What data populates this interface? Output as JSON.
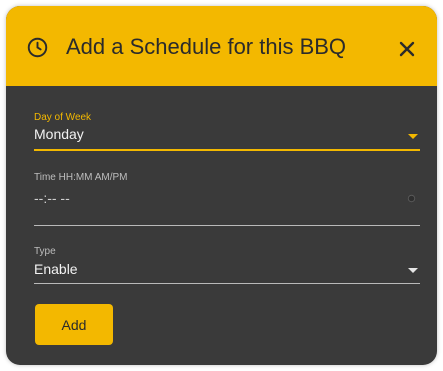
{
  "dialog": {
    "title": "Add a Schedule for this BBQ",
    "header_icon": "clock-icon",
    "close_icon": "close-icon"
  },
  "form": {
    "day_of_week": {
      "label": "Day of Week",
      "value": "Monday",
      "state": "focused",
      "icon": "dropdown-caret-icon"
    },
    "time": {
      "label": "Time HH:MM AM/PM",
      "value": "--:-- --",
      "icon": "clock-dot-icon"
    },
    "type": {
      "label": "Type",
      "value": "Enable",
      "icon": "dropdown-caret-icon"
    }
  },
  "actions": {
    "add_label": "Add"
  },
  "colors": {
    "accent": "#f3b800",
    "surface": "#3a3a3a",
    "text_light": "#f2f2f2",
    "text_dark": "#2b2b2b",
    "muted": "#bdbdbd"
  }
}
